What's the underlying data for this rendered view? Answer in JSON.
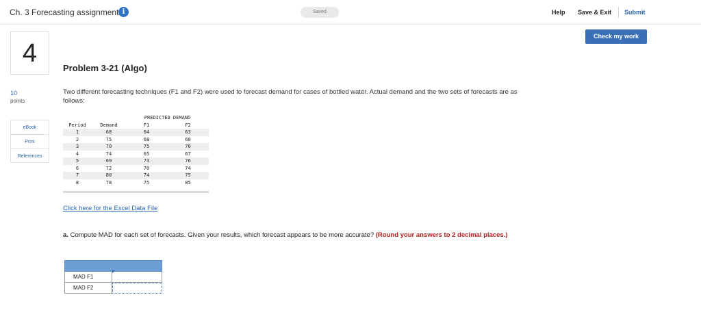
{
  "header": {
    "assignment_title": "Ch. 3 Forecasting assignments",
    "info_icon": "i",
    "saved_status": "Saved",
    "help": "Help",
    "save_exit": "Save & Exit",
    "submit": "Submit"
  },
  "check_button": "Check my work",
  "question": {
    "number": "4",
    "points_value": "10",
    "points_label": "points",
    "title": "Problem 3-21 (Algo)",
    "prompt": "Two different forecasting techniques (F1 and F2) were used to forecast demand for cases of bottled water. Actual demand and the two sets of forecasts are as follows:"
  },
  "side_buttons": {
    "ebook": "eBook",
    "print": "Print",
    "references": "References"
  },
  "demand_table": {
    "group_header": "PREDICTED DEMAND",
    "columns": [
      "Period",
      "Demand",
      "F1",
      "F2"
    ],
    "rows": [
      [
        "1",
        "68",
        "64",
        "63"
      ],
      [
        "2",
        "75",
        "68",
        "60"
      ],
      [
        "3",
        "70",
        "75",
        "70"
      ],
      [
        "4",
        "74",
        "65",
        "67"
      ],
      [
        "5",
        "69",
        "73",
        "76"
      ],
      [
        "6",
        "72",
        "70",
        "74"
      ],
      [
        "7",
        "80",
        "74",
        "75"
      ],
      [
        "8",
        "78",
        "75",
        "85"
      ]
    ]
  },
  "excel_link": "Click here for the Excel Data File",
  "part_a": {
    "prefix": "a.",
    "text": " Compute MAD for each set of forecasts. Given your results, which forecast appears to be more accurate? ",
    "instruction": "(Round your answers to 2 decimal places.)"
  },
  "answer_table": {
    "rows": [
      {
        "label": "MAD F1",
        "value": ""
      },
      {
        "label": "MAD F2",
        "value": ""
      }
    ]
  }
}
